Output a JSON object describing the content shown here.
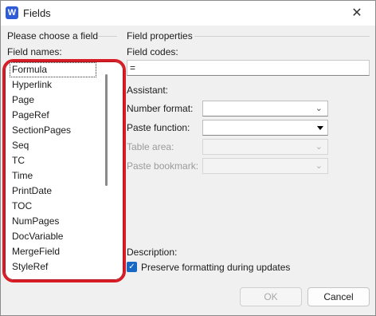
{
  "window": {
    "title": "Fields",
    "app_icon": "W"
  },
  "left": {
    "group_label": "Please choose a field",
    "list_label": "Field names:",
    "items": [
      "Formula",
      "Hyperlink",
      "Page",
      "PageRef",
      "SectionPages",
      "Seq",
      "TC",
      "Time",
      "PrintDate",
      "TOC",
      "NumPages",
      "DocVariable",
      "MergeField",
      "StyleRef"
    ],
    "selected_index": 0
  },
  "right": {
    "group_label": "Field properties",
    "field_codes_label": "Field codes:",
    "field_codes_value": "=",
    "assistant_label": "Assistant:",
    "number_format_label": "Number format:",
    "paste_function_label": "Paste function:",
    "table_area_label": "Table area:",
    "paste_bookmark_label": "Paste bookmark:",
    "description_label": "Description:",
    "preserve_label": "Preserve formatting during updates"
  },
  "buttons": {
    "ok": "OK",
    "cancel": "Cancel"
  },
  "colors": {
    "highlight": "#d71c26",
    "accent": "#1868c4"
  }
}
